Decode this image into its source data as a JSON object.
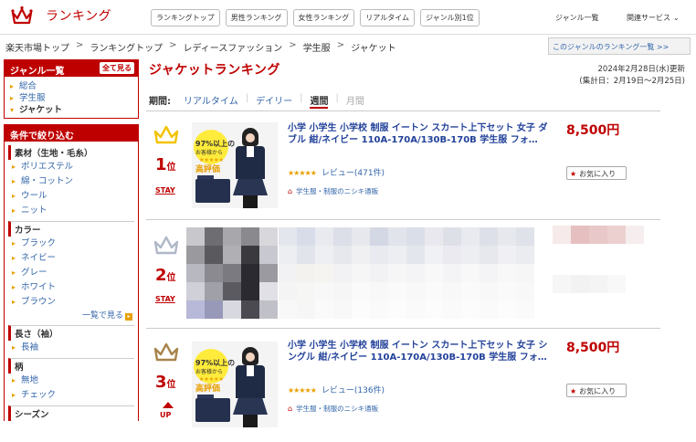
{
  "header": {
    "logo_text": "ランキング",
    "nav": [
      "ランキングトップ",
      "男性ランキング",
      "女性ランキング",
      "リアルタイム",
      "ジャンル別1位"
    ],
    "genre_list": "ジャンル一覧",
    "related_services": "関連サービス"
  },
  "breadcrumb": [
    "楽天市場トップ",
    "ランキングトップ",
    "レディースファッション",
    "学生服",
    "ジャケット"
  ],
  "genre_ranking_link": "このジャンルのランキング一覧 >>",
  "sidebar": {
    "genre_title": "ジャンル一覧",
    "show_all": "全て見る",
    "genres": [
      {
        "label": "総合",
        "active": false
      },
      {
        "label": "学生服",
        "active": false
      },
      {
        "label": "ジャケット",
        "active": true
      }
    ],
    "filter_title": "条件で絞り込む",
    "filters": [
      {
        "category": "素材（生地・毛糸）",
        "items": [
          "ポリエステル",
          "綿・コットン",
          "ウール",
          "ニット"
        ]
      },
      {
        "category": "カラー",
        "items": [
          "ブラック",
          "ネイビー",
          "グレー",
          "ホワイト",
          "ブラウン"
        ],
        "more": "一覧で見る"
      },
      {
        "category": "長さ（袖）",
        "items": [
          "長袖"
        ]
      },
      {
        "category": "柄",
        "items": [
          "無地",
          "チェック"
        ]
      },
      {
        "category": "シーズン",
        "items": []
      }
    ]
  },
  "main": {
    "title": "ジャケットランキング",
    "updated_line1": "2024年2月28日(水)更新",
    "updated_line2": "(集計日：2月19日～2月25日)",
    "period_label": "期間:",
    "period_options": [
      {
        "label": "リアルタイム",
        "state": "link"
      },
      {
        "label": "デイリー",
        "state": "link"
      },
      {
        "label": "週間",
        "state": "selected"
      },
      {
        "label": "月間",
        "state": "disabled"
      }
    ]
  },
  "items": [
    {
      "rank": "1",
      "rank_suffix": "位",
      "status": "STAY",
      "crown_color": "#f2c200",
      "title": "小学 小学生 小学校 制服 イートン スカート上下セット 女子 ダブル 紺/ネイビー 110A-170A/130B-170B 学生服 フォ…",
      "price": "8,500円",
      "stars": "★★★★★",
      "review": "レビュー(471件)",
      "shop": "学生服・制服のニシキ通販",
      "favorite": "お気に入り",
      "badge_line1": "97%以上の",
      "badge_line2": "お客様から",
      "badge_line3": "高評価"
    },
    {
      "rank": "2",
      "rank_suffix": "位",
      "status": "STAY",
      "crown_color": "#b0b8c8",
      "blurred": true
    },
    {
      "rank": "3",
      "rank_suffix": "位",
      "status": "UP",
      "crown_color": "#a8834a",
      "title": "小学 小学生 小学校 制服 イートン スカート上下セット 女子 シングル 紺/ネイビー 110A-170A/130B-170B 学生服 フォ…",
      "price": "8,500円",
      "stars": "★★★★★",
      "review": "レビュー(136件)",
      "shop": "学生服・制服のニシキ通販",
      "favorite": "お気に入り",
      "badge_line1": "97%以上の",
      "badge_line2": "お客様から",
      "badge_line3": "高評価"
    }
  ]
}
